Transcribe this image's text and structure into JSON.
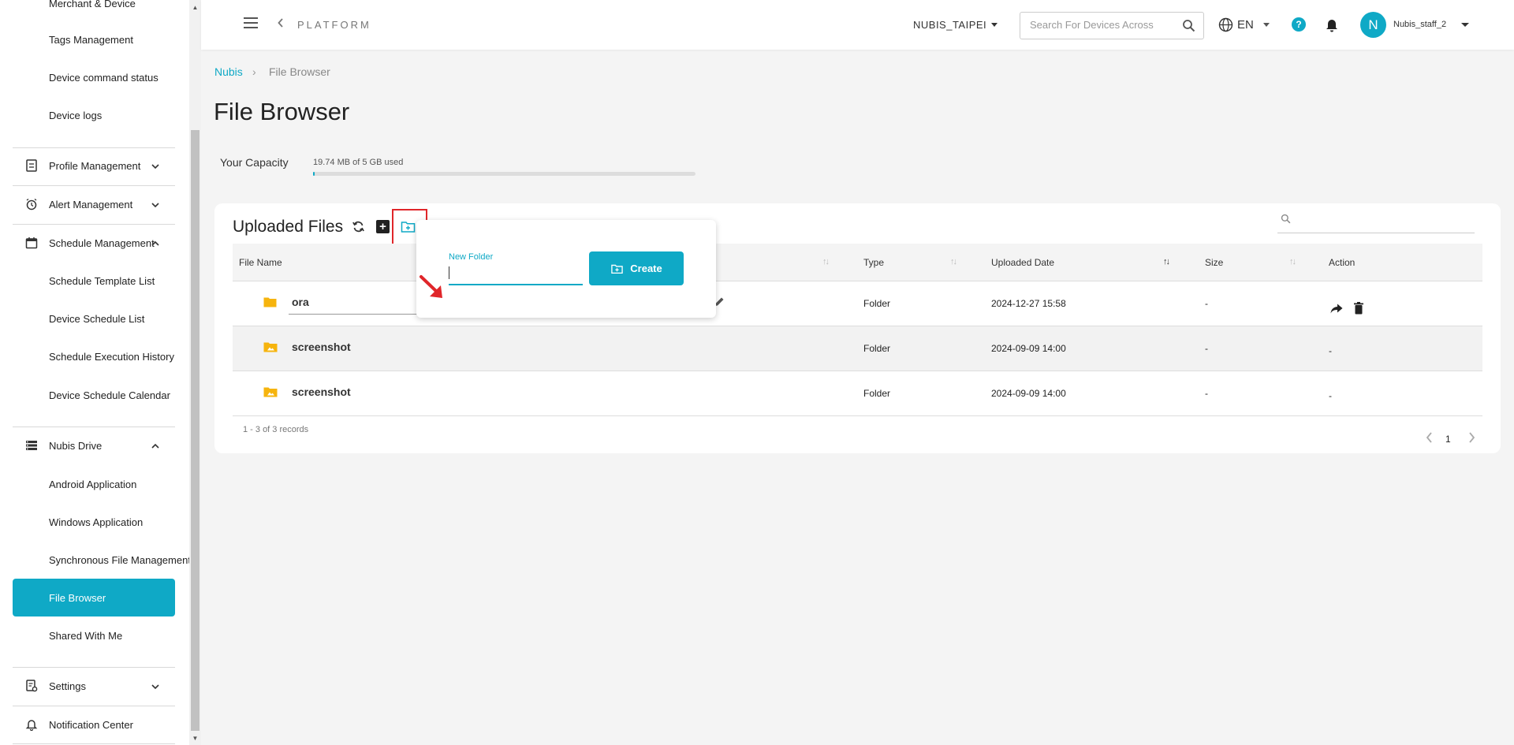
{
  "sidebar": {
    "items": [
      {
        "label": "Merchant & Device",
        "kind": "sub"
      },
      {
        "label": "Tags Management",
        "kind": "sub"
      },
      {
        "label": "Device command status",
        "kind": "sub"
      },
      {
        "label": "Device logs",
        "kind": "sub"
      },
      {
        "label": "Profile Management",
        "kind": "parent",
        "icon": "profile-icon",
        "expanded": false
      },
      {
        "label": "Alert Management",
        "kind": "parent",
        "icon": "alarm-icon",
        "expanded": false
      },
      {
        "label": "Schedule Management",
        "kind": "parent",
        "icon": "calendar-icon",
        "expanded": true
      },
      {
        "label": "Schedule Template List",
        "kind": "sub"
      },
      {
        "label": "Device Schedule List",
        "kind": "sub"
      },
      {
        "label": "Schedule Execution History",
        "kind": "sub"
      },
      {
        "label": "Device Schedule Calendar",
        "kind": "sub"
      },
      {
        "label": "Nubis Drive",
        "kind": "parent",
        "icon": "storage-icon",
        "expanded": true
      },
      {
        "label": "Android Application",
        "kind": "sub"
      },
      {
        "label": "Windows Application",
        "kind": "sub"
      },
      {
        "label": "Synchronous File Management",
        "kind": "sub"
      },
      {
        "label": "File Browser",
        "kind": "sub",
        "active": true
      },
      {
        "label": "Shared With Me",
        "kind": "sub"
      },
      {
        "label": "Settings",
        "kind": "parent",
        "icon": "settings-doc-icon",
        "expanded": false
      },
      {
        "label": "Notification Center",
        "kind": "parent",
        "icon": "bell-outline-icon"
      }
    ]
  },
  "header": {
    "platform_label": "PLATFORM",
    "org_name": "NUBIS_TAIPEI",
    "search_placeholder": "Search For Devices Across",
    "language": "EN",
    "help_glyph": "?",
    "avatar_letter": "N",
    "username": "Nubis_staff_2"
  },
  "breadcrumb": {
    "root": "Nubis",
    "separator": "›",
    "current": "File Browser"
  },
  "page_title": "File Browser",
  "capacity": {
    "label": "Your Capacity",
    "usage_text": "19.74 MB of 5 GB used",
    "used_fraction": 0.004
  },
  "files": {
    "title": "Uploaded Files",
    "add_glyph": "+",
    "columns": {
      "name": "File Name",
      "type": "Type",
      "date": "Uploaded Date",
      "size": "Size",
      "action": "Action"
    },
    "rows": [
      {
        "name": "ora",
        "type": "Folder",
        "date": "2024-12-27 15:58",
        "size": "-",
        "action": "",
        "icon": "folder-icon"
      },
      {
        "name": "screenshot",
        "type": "Folder",
        "date": "2024-09-09 14:00",
        "size": "-",
        "action": "-",
        "icon": "image-folder-icon"
      },
      {
        "name": "screenshot",
        "type": "Folder",
        "date": "2024-09-09 14:00",
        "size": "-",
        "action": "-",
        "icon": "image-folder-icon"
      }
    ],
    "records": "1 - 3 of 3 records",
    "page": "1"
  },
  "popover": {
    "label": "New Folder",
    "value": "",
    "create_label": "Create"
  },
  "colors": {
    "accent": "#0fa9c6",
    "highlight": "#e0262a",
    "folder": "#f6b40e"
  }
}
